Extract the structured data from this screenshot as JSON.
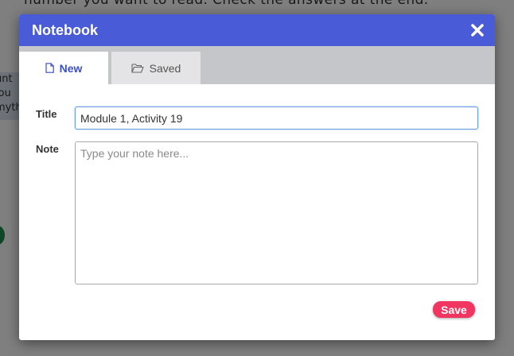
{
  "background": {
    "instruction_text": "number you want to read. Check the answers at the end.",
    "sidecard_lines": [
      "unt",
      "jou",
      "myth"
    ]
  },
  "modal": {
    "title": "Notebook",
    "close_icon": "close-icon",
    "tabs": [
      {
        "label": "New",
        "icon": "file-icon",
        "active": true
      },
      {
        "label": "Saved",
        "icon": "folder-open-icon",
        "active": false
      }
    ],
    "form": {
      "title_label": "Title",
      "title_value": "Module 1, Activity 19",
      "note_label": "Note",
      "note_value": "",
      "note_placeholder": "Type your note here..."
    },
    "save_label": "Save"
  },
  "colors": {
    "header": "#4a5bd8",
    "tabbar": "#c5c6ca",
    "active_tab_text": "#3a4fcc",
    "save_button": "#f03560"
  }
}
